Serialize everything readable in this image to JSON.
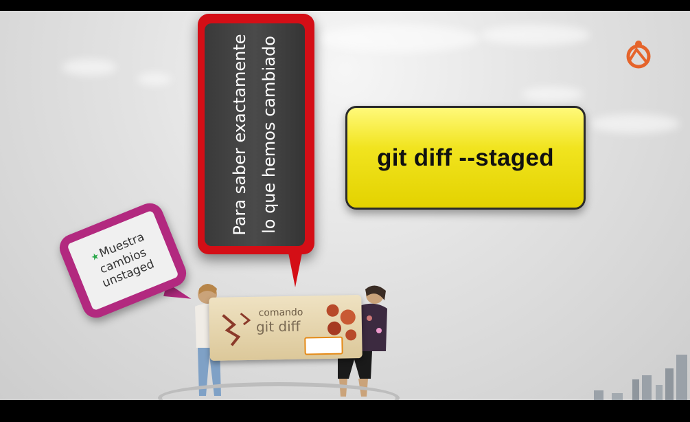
{
  "red_bubble": {
    "line1": "Para saber exactamente",
    "line2": "lo que hemos cambiado"
  },
  "yellow_box": {
    "text": "git diff --staged"
  },
  "pink_bubble": {
    "line1": "Muestra",
    "line2": "cambios",
    "line3": "unstaged"
  },
  "banner": {
    "line1": "comando",
    "line2": "git diff"
  },
  "colors": {
    "red": "#d40e16",
    "yellow": "#f1e41f",
    "magenta": "#b2297f",
    "logo": "#e5642b"
  }
}
